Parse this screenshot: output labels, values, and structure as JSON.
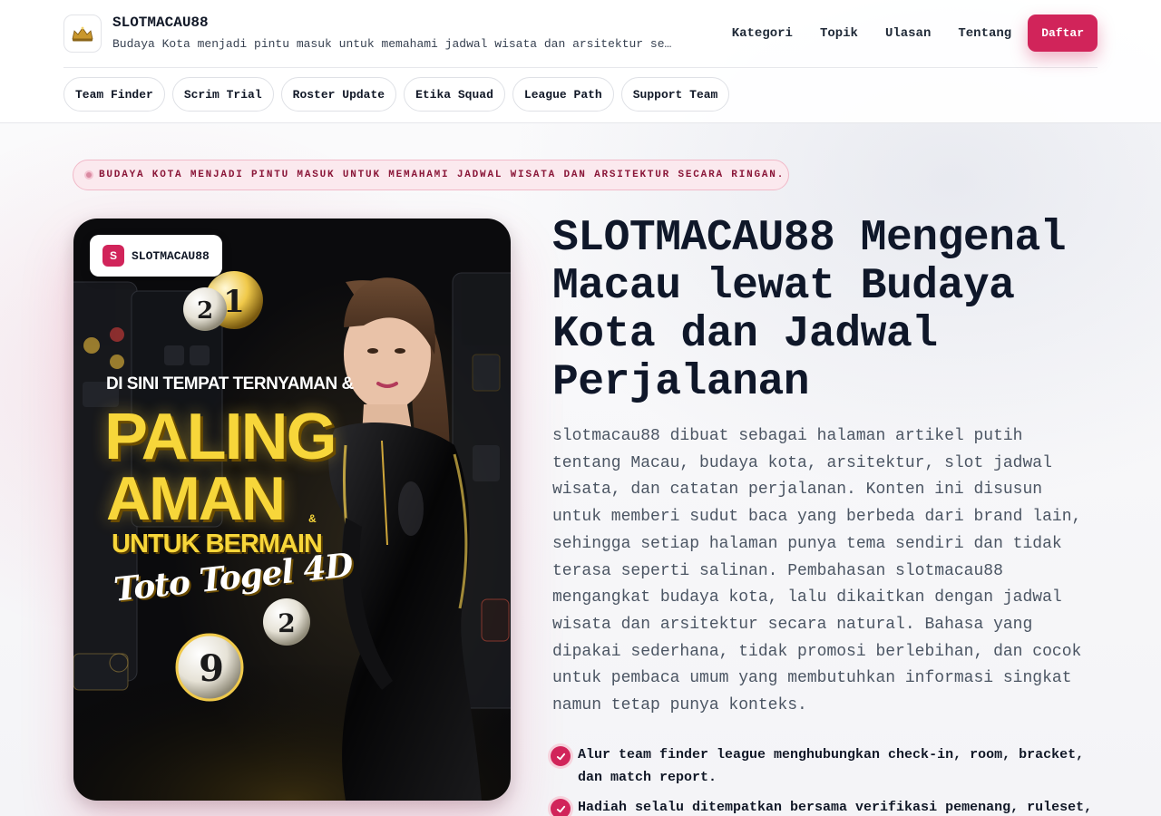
{
  "header": {
    "brand_name": "SLOTMACAU88",
    "tagline": "Budaya Kota menjadi pintu masuk untuk memahami jadwal wisata dan arsitektur secara…",
    "logo_icon": "gold-crown-icon",
    "nav": [
      {
        "label": "Kategori"
      },
      {
        "label": "Topik"
      },
      {
        "label": "Ulasan"
      },
      {
        "label": "Tentang"
      }
    ],
    "cta_label": "Daftar"
  },
  "chips": [
    {
      "label": "Team Finder"
    },
    {
      "label": "Scrim Trial"
    },
    {
      "label": "Roster Update"
    },
    {
      "label": "Etika Squad"
    },
    {
      "label": "League Path"
    },
    {
      "label": "Support Team"
    }
  ],
  "hero": {
    "eyebrow": "BUDAYA KOTA MENJADI PINTU MASUK UNTUK MEMAHAMI JADWAL WISATA DAN ARSITEKTUR SECARA RINGAN.",
    "card_badge": {
      "mark": "S",
      "label": "SLOTMACAU88"
    },
    "poster": {
      "line1": "DI SINI TEMPAT TERNYAMAN &",
      "big1": "PALING",
      "big2": "AMAN",
      "amp": "&",
      "line3": "UNTUK BERMAIN",
      "script": "Toto Togel 4D"
    },
    "title": "SLOTMACAU88 Mengenal Macau lewat Budaya Kota dan Jadwal Perjalanan",
    "lead": "slotmacau88 dibuat sebagai halaman artikel putih tentang Macau, budaya kota, arsitektur, slot jadwal wisata, dan catatan perjalanan. Konten ini disusun untuk memberi sudut baca yang berbeda dari brand lain, sehingga setiap halaman punya tema sendiri dan tidak terasa seperti salinan. Pembahasan slotmacau88 mengangkat budaya kota, lalu dikaitkan dengan jadwal wisata dan arsitektur secara natural. Bahasa yang dipakai sederhana, tidak promosi berlebihan, dan cocok untuk pembaca umum yang membutuhkan informasi singkat namun tetap punya konteks.",
    "bullets": [
      {
        "text": "Alur team finder league menghubungkan check-in, room, bracket, dan match report."
      },
      {
        "text": "Hadiah selalu ditempatkan bersama verifikasi pemenang, ruleset,"
      }
    ]
  },
  "colors": {
    "accent": "#d1245a",
    "ink": "#0f1729",
    "muted": "#4b5563"
  }
}
